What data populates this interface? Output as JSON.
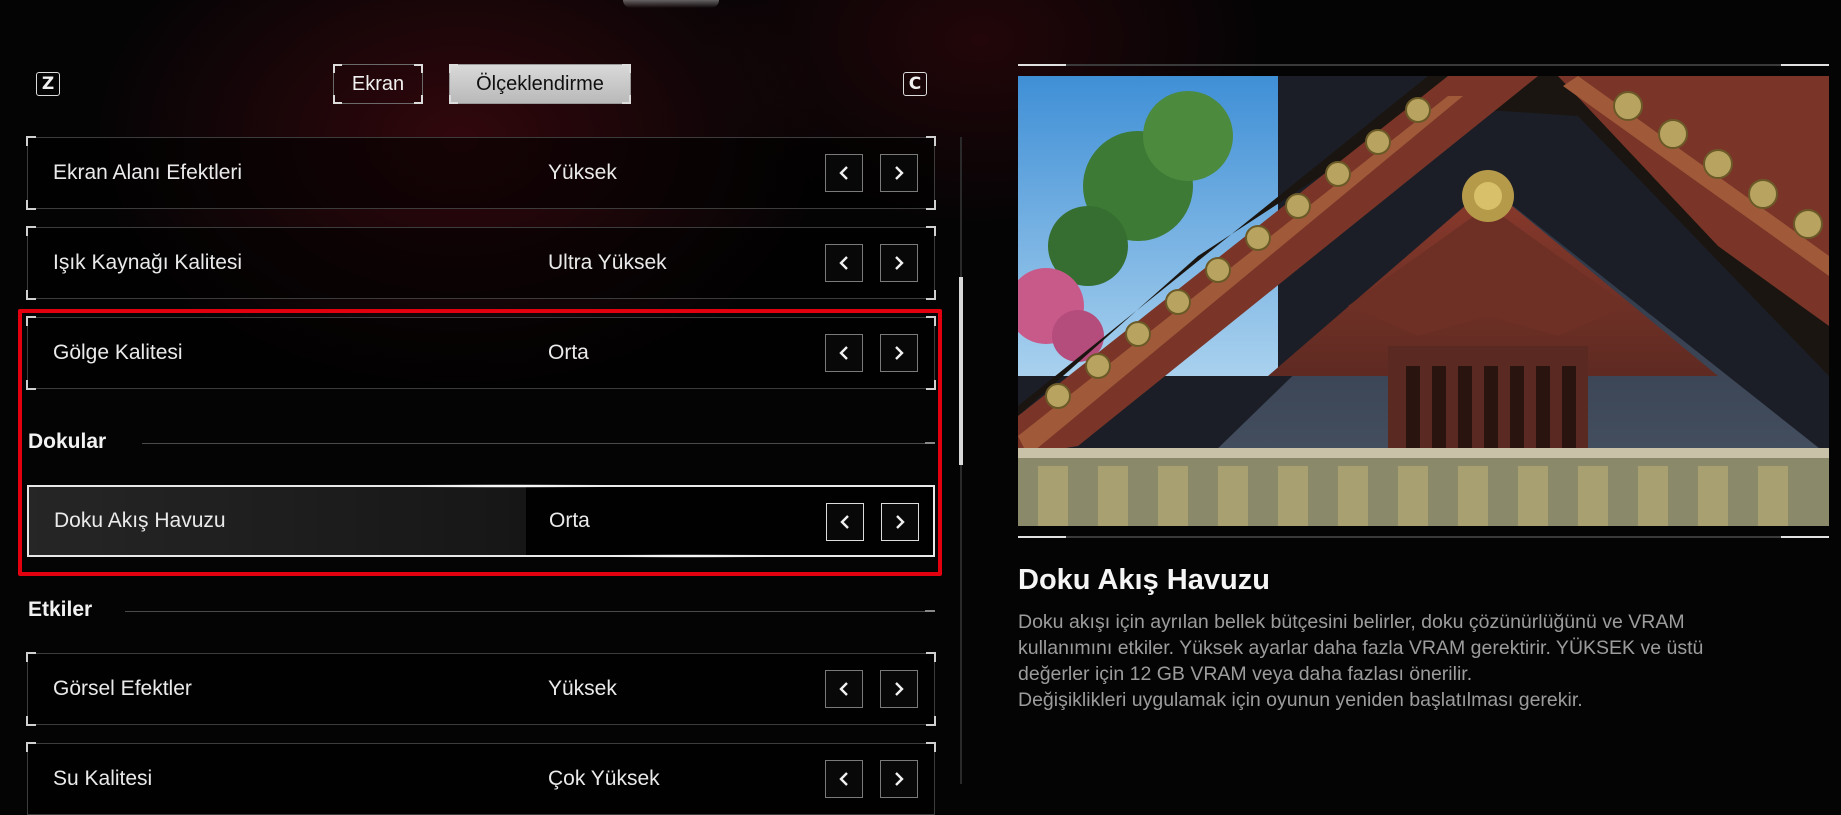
{
  "key_hints": {
    "left": "Z",
    "right": "C"
  },
  "tabs": [
    {
      "label": "Ekran",
      "active": false
    },
    {
      "label": "Ölçeklendirme",
      "active": true
    }
  ],
  "settings": {
    "screen_space_effects": {
      "label": "Ekran Alanı Efektleri",
      "value": "Yüksek"
    },
    "light_source_quality": {
      "label": "Işık Kaynağı Kalitesi",
      "value": "Ultra Yüksek"
    },
    "shadow_quality": {
      "label": "Gölge Kalitesi",
      "value": "Orta"
    },
    "texture_streaming_pool": {
      "label": "Doku Akış Havuzu",
      "value": "Orta"
    },
    "visual_effects": {
      "label": "Görsel Efektler",
      "value": "Yüksek"
    },
    "water_quality": {
      "label": "Su Kalitesi",
      "value": "Çok Yüksek"
    }
  },
  "sections": {
    "textures": "Dokular",
    "effects": "Etkiler"
  },
  "info": {
    "title": "Doku Akış Havuzu",
    "desc_lines": [
      "Doku akışı için ayrılan bellek bütçesini belirler, doku çözünürlüğünü ve VRAM",
      "kullanımını etkiler. Yüksek ayarlar daha fazla VRAM gerektirir. YÜKSEK ve üstü",
      "değerler için 12 GB VRAM veya daha fazlası önerilir.",
      "Değişiklikleri uygulamak için oyunun yeniden başlatılması gerekir."
    ]
  },
  "colors": {
    "highlight": "#e3000f",
    "accent_bg": "#050405",
    "selected_tab": "#c8c8c8"
  },
  "icons": {
    "prev": "chevron-left-icon",
    "next": "chevron-right-icon"
  }
}
